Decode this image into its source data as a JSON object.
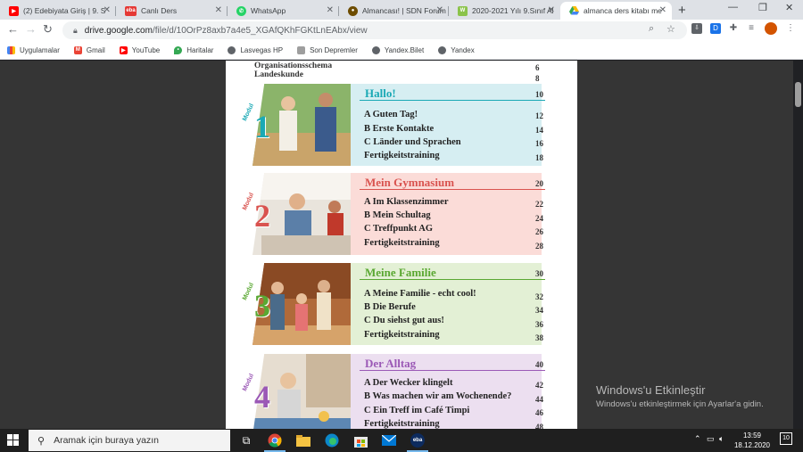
{
  "tabs": [
    {
      "title": "(2) Edebiyata Giriş | 9. S",
      "icon": "youtube-icon",
      "color": "#ff0000"
    },
    {
      "title": "Canlı Ders",
      "icon": "eba-icon",
      "color": "#e53935"
    },
    {
      "title": "WhatsApp",
      "icon": "whatsapp-icon",
      "color": "#25d366"
    },
    {
      "title": "Almancası! | SDN Forum",
      "icon": "sdn-icon",
      "color": "#6d4c00"
    },
    {
      "title": "2020-2021 Yılı 9.Sınıf Al",
      "icon": "site-icon",
      "color": "#8bc34a"
    },
    {
      "title": "almanca ders kitabı me",
      "icon": "google-drive-icon",
      "color": "#1a73e8"
    }
  ],
  "toolbar": {
    "url_host": "drive.google.com",
    "url_path": "/file/d/10OrPz8axb7a4e5_XGAfQKhFGKtLnEAbx/view"
  },
  "bookmarks": [
    {
      "label": "Uygulamalar",
      "icon": "apps-grid-icon"
    },
    {
      "label": "Gmail",
      "icon": "gmail-icon"
    },
    {
      "label": "YouTube",
      "icon": "youtube-icon"
    },
    {
      "label": "Haritalar",
      "icon": "maps-icon"
    },
    {
      "label": "Lasvegas HP",
      "icon": "globe-icon"
    },
    {
      "label": "Son Depremler",
      "icon": "bookmark-icon"
    },
    {
      "label": "Yandex.Bilet",
      "icon": "globe-icon"
    },
    {
      "label": "Yandex",
      "icon": "globe-icon"
    }
  ],
  "document": {
    "pre_items": [
      {
        "label": "Organisationsschema",
        "page": "6"
      },
      {
        "label": "Landeskunde",
        "page": "8"
      }
    ],
    "modules": [
      {
        "label": "Modul",
        "number": "1",
        "title": "Hallo!",
        "page": "10",
        "accent": "#1aa9b5",
        "band": "#d6eef2",
        "lessons": [
          {
            "text": "A  Guten Tag!",
            "page": "12"
          },
          {
            "text": "B  Erste Kontakte",
            "page": "14"
          },
          {
            "text": "C  Länder und Sprachen",
            "page": "16"
          },
          {
            "text": "Fertigkeitstraining",
            "page": "18"
          }
        ]
      },
      {
        "label": "Modul",
        "number": "2",
        "title": "Mein Gymnasium",
        "page": "20",
        "accent": "#d9534f",
        "band": "#fbdcd8",
        "lessons": [
          {
            "text": "A  Im Klassenzimmer",
            "page": "22"
          },
          {
            "text": "B  Mein Schultag",
            "page": "24"
          },
          {
            "text": "C  Treffpunkt AG",
            "page": "26"
          },
          {
            "text": "Fertigkeitstraining",
            "page": "28"
          }
        ]
      },
      {
        "label": "Modul",
        "number": "3",
        "title": "Meine Familie",
        "page": "30",
        "accent": "#5aa832",
        "band": "#e3f0d5",
        "lessons": [
          {
            "text": "A  Meine Familie - echt cool!",
            "page": "32"
          },
          {
            "text": "B  Die Berufe",
            "page": "34"
          },
          {
            "text": "C  Du siehst gut aus!",
            "page": "36"
          },
          {
            "text": "Fertigkeitstraining",
            "page": "38"
          }
        ]
      },
      {
        "label": "Modul",
        "number": "4",
        "title": "Der Alltag",
        "page": "40",
        "accent": "#9b59b6",
        "band": "#ecdff0",
        "lessons": [
          {
            "text": "A  Der Wecker klingelt",
            "page": "42"
          },
          {
            "text": "B  Was machen wir am Wochenende?",
            "page": "44"
          },
          {
            "text": "C  Ein Treff im Café Timpi",
            "page": "46"
          },
          {
            "text": "Fertigkeitstraining",
            "page": "48"
          }
        ]
      }
    ]
  },
  "activation": {
    "title": "Windows'u Etkinleştir",
    "subtitle": "Windows'u etkinleştirmek için Ayarlar'a gidin."
  },
  "taskbar": {
    "search_placeholder": "Aramak için buraya yazın",
    "time": "13:59",
    "date": "18.12.2020",
    "notification_count": "10"
  }
}
